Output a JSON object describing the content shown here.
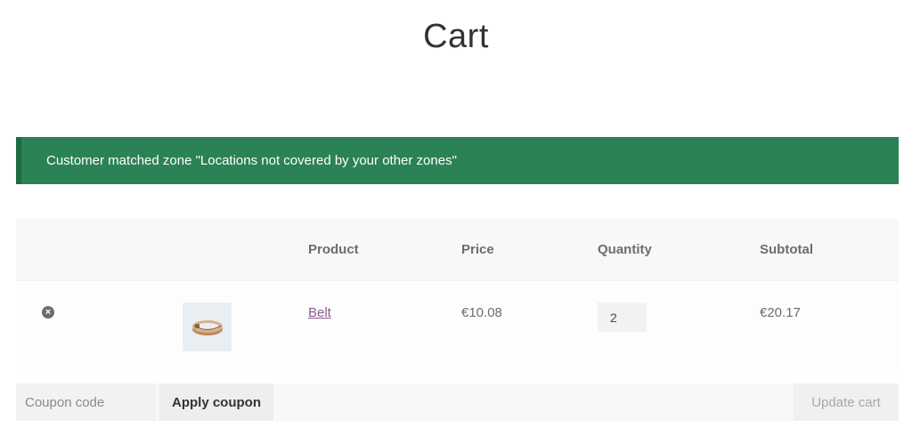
{
  "page": {
    "title": "Cart"
  },
  "notice": {
    "message": "Customer matched zone \"Locations not covered by your other zones\"",
    "color": "#2b8254"
  },
  "table": {
    "headers": {
      "product": "Product",
      "price": "Price",
      "quantity": "Quantity",
      "subtotal": "Subtotal"
    },
    "rows": [
      {
        "remove_icon": "remove-circle-icon",
        "thumbnail": "belt-image",
        "product": "Belt",
        "price": "€10.08",
        "quantity": "2",
        "subtotal": "€20.17"
      }
    ]
  },
  "actions": {
    "coupon_placeholder": "Coupon code",
    "apply_label": "Apply coupon",
    "update_label": "Update cart"
  },
  "colors": {
    "link": "#8f5a8a",
    "notice_bg": "#2b8254"
  }
}
